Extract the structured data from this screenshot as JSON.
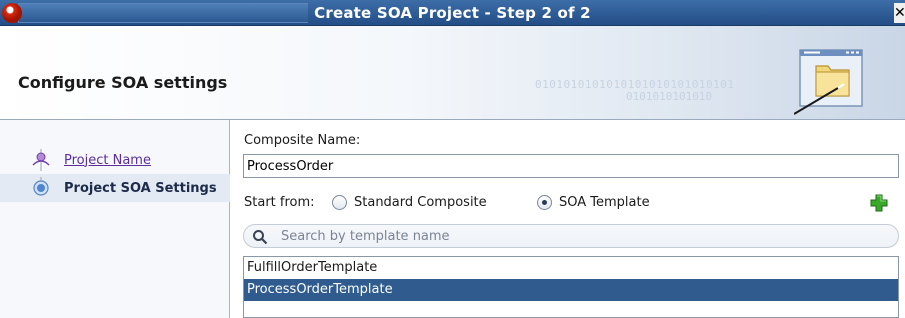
{
  "window": {
    "title": "Create SOA Project - Step 2 of 2",
    "close_glyph": "✕"
  },
  "banner": {
    "title": "Configure SOA settings",
    "decor_binary_1": "0101010101010101010101010101",
    "decor_binary_2": "0101010101010"
  },
  "nav": {
    "items": [
      {
        "label": "Project Name",
        "state": "visited",
        "icon": "step-person-icon"
      },
      {
        "label": "Project SOA Settings",
        "state": "current",
        "icon": "step-current-icon"
      }
    ]
  },
  "form": {
    "composite_name_label": "Composite Name:",
    "composite_name_value": "ProcessOrder",
    "start_from_label": "Start from:",
    "options": [
      {
        "label": "Standard Composite",
        "checked": false
      },
      {
        "label": "SOA Template",
        "checked": true
      }
    ],
    "search_placeholder": "Search by template name",
    "templates": [
      {
        "name": "FulfillOrderTemplate",
        "selected": false
      },
      {
        "name": "ProcessOrderTemplate",
        "selected": true
      }
    ]
  },
  "colors": {
    "titlebar": "#2c5890",
    "selection": "#2f5b8f",
    "link": "#5a2f9a",
    "add_icon": "#3aa82a"
  }
}
